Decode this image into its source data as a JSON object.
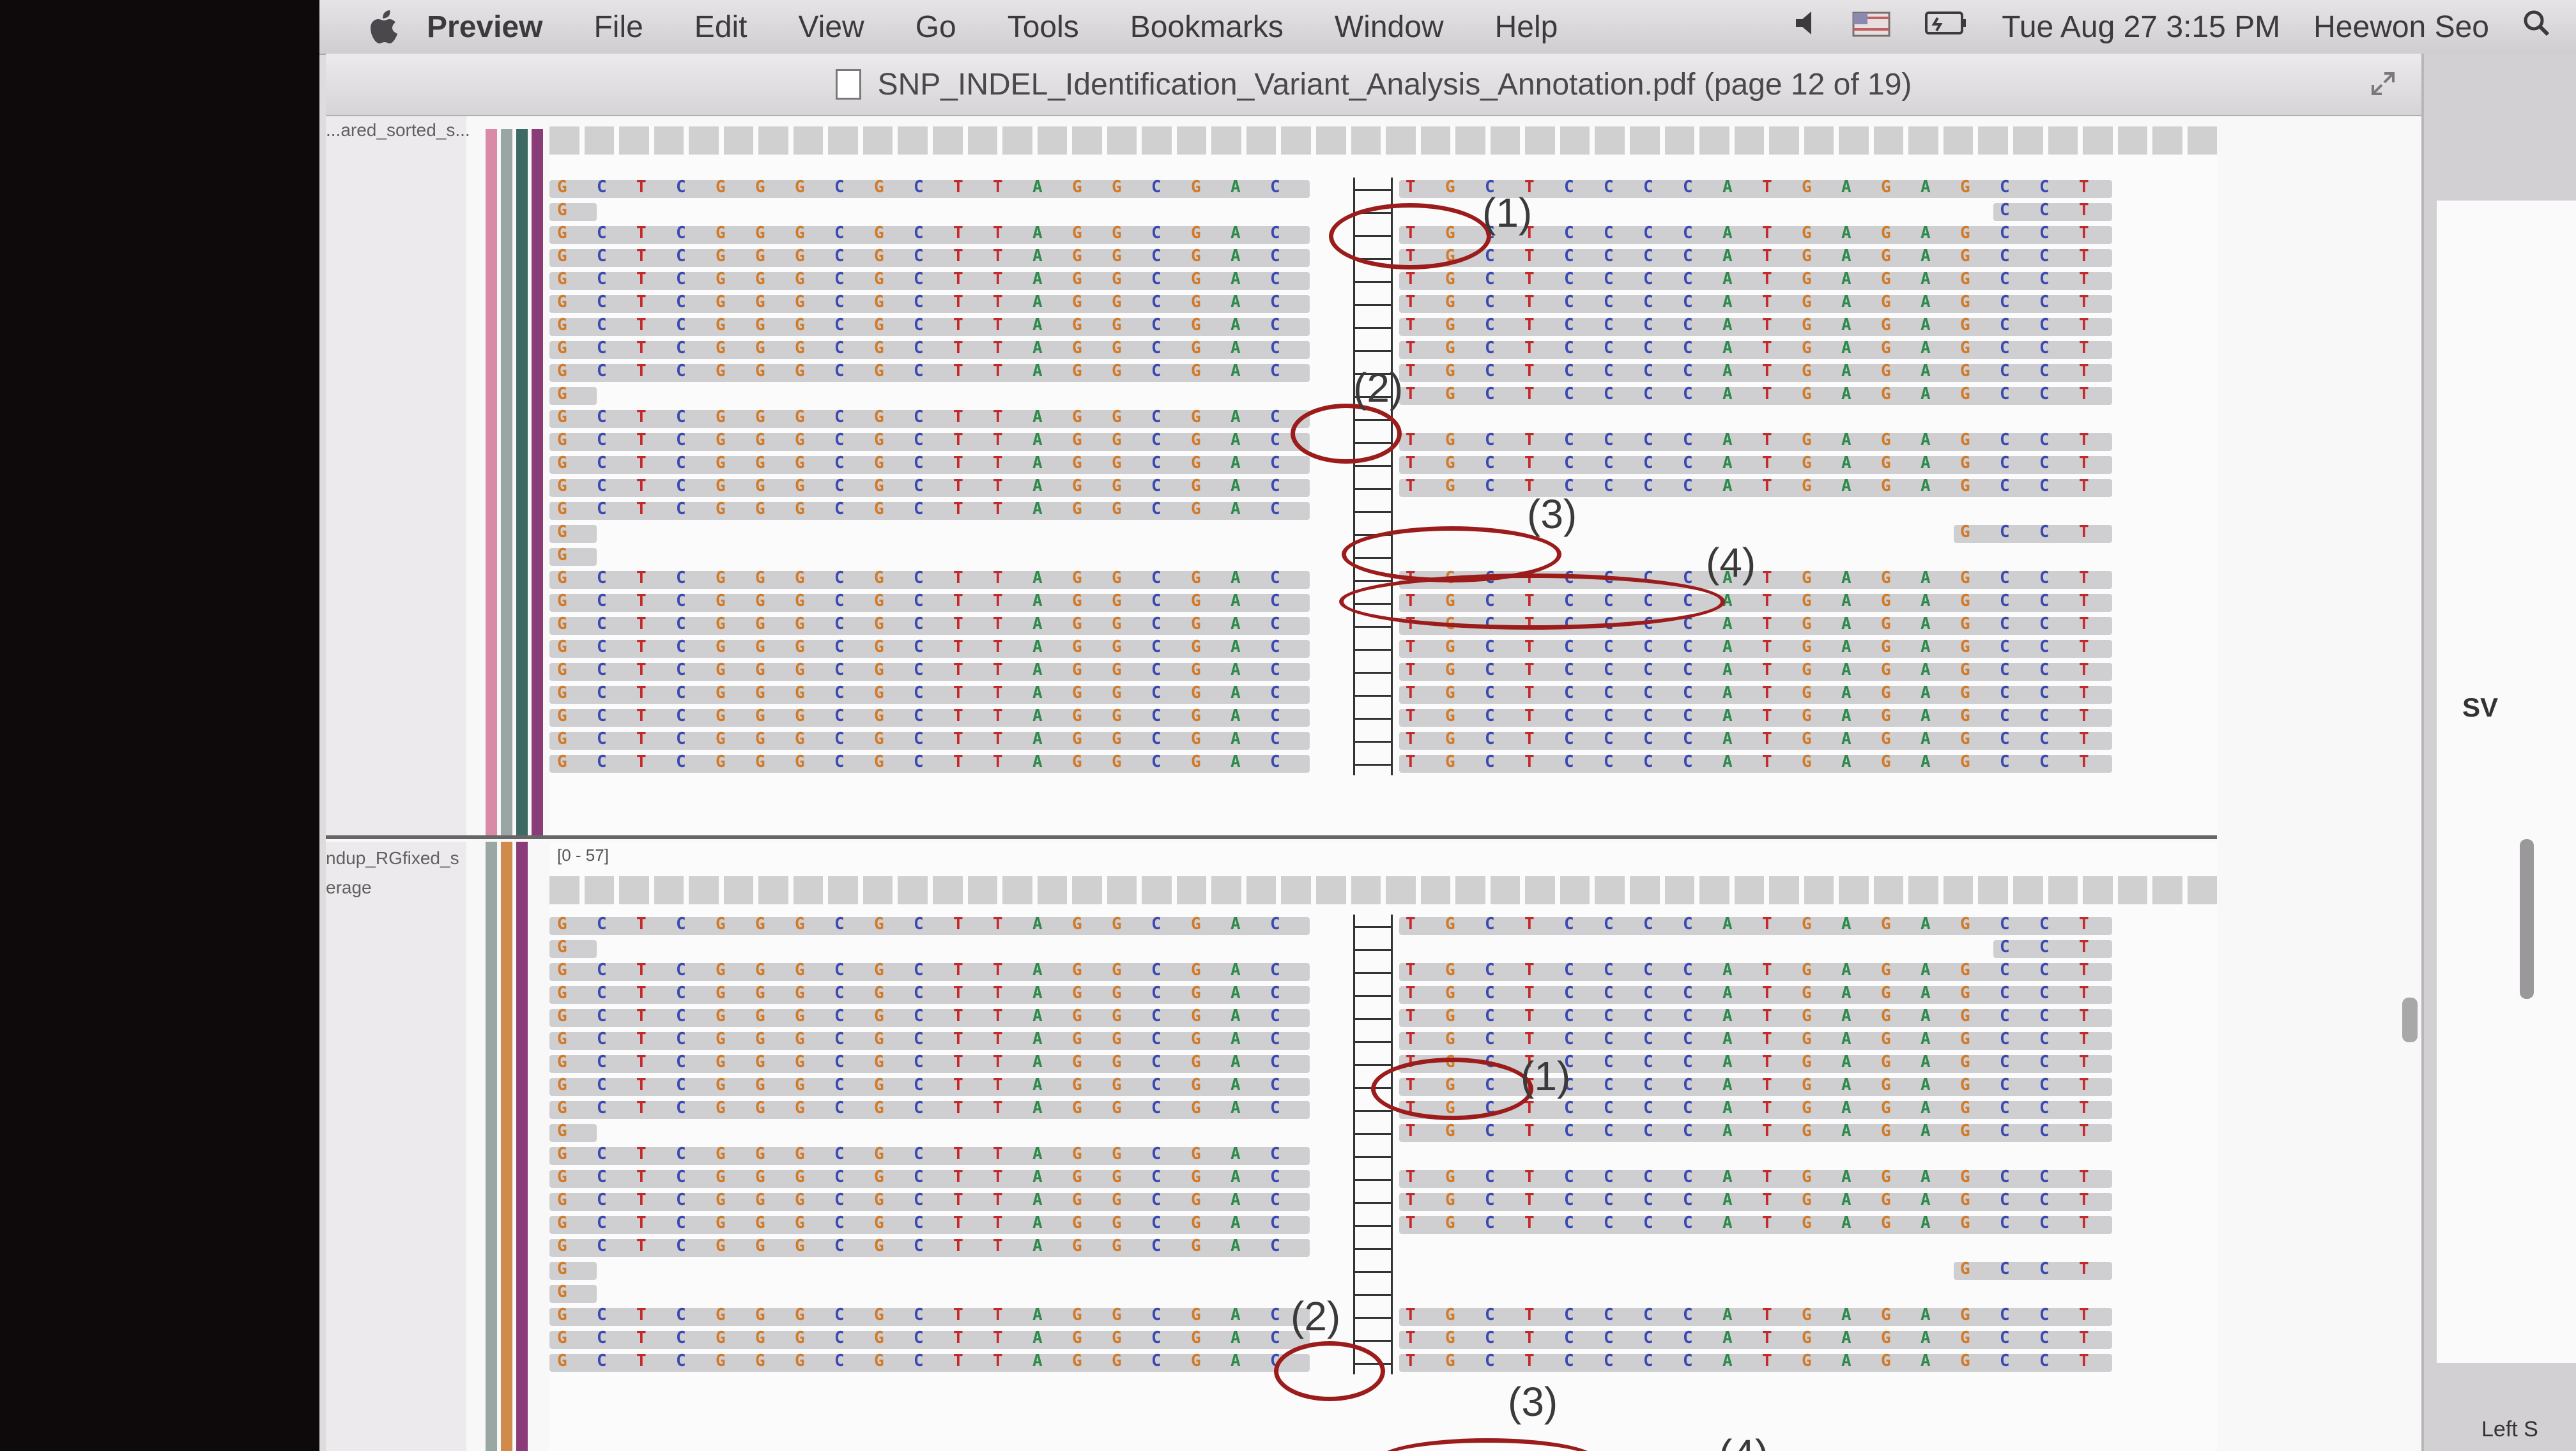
{
  "menubar": {
    "items": [
      "Preview",
      "File",
      "Edit",
      "View",
      "Go",
      "Tools",
      "Bookmarks",
      "Window",
      "Help"
    ],
    "datetime": "Tue Aug 27  3:15 PM",
    "user": "Heewon Seo"
  },
  "window": {
    "title": "SNP_INDEL_Identification_Variant_Analysis_Annotation.pdf (page 12 of 19)"
  },
  "igv": {
    "top_track_label": "...ared_sorted_s...",
    "bottom_track_label": "ndup_RGfixed_s",
    "bottom_track_sublabel": "erage",
    "range_label": "[0 - 57]",
    "annotations": [
      "(1)",
      "(2)",
      "(3)",
      "(4)"
    ]
  },
  "right_pane": {
    "label": "SV",
    "bottom_text": "Left S"
  },
  "colors": {
    "circle": "#9c1c1c",
    "base_A": "#2e8a4a",
    "base_C": "#3a4ab0",
    "base_G": "#d07a2a",
    "base_T": "#c42a2a"
  }
}
